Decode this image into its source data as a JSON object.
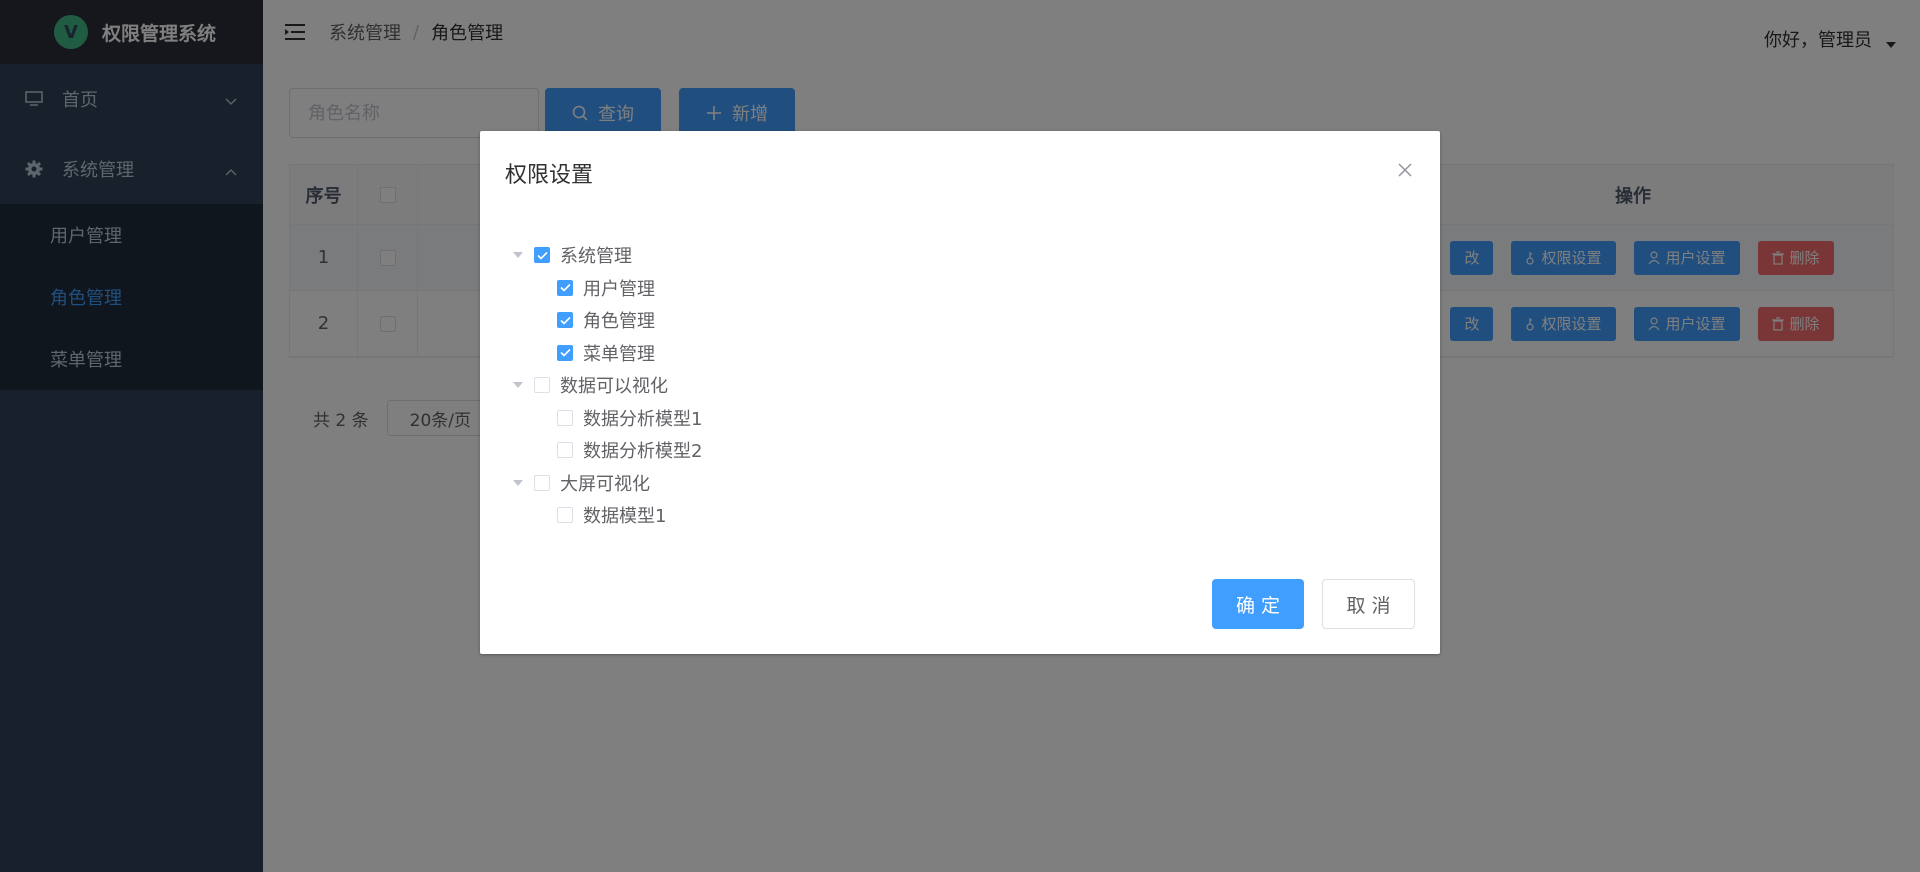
{
  "app": {
    "title": "权限管理系统",
    "logo_letter": "V"
  },
  "sidebar": {
    "items": [
      {
        "label": "首页",
        "icon": "monitor-icon"
      },
      {
        "label": "系统管理",
        "icon": "gear-icon"
      }
    ],
    "submenu": [
      {
        "label": "用户管理",
        "active": false
      },
      {
        "label": "角色管理",
        "active": true
      },
      {
        "label": "菜单管理",
        "active": false
      }
    ]
  },
  "header": {
    "breadcrumb": [
      "系统管理",
      "角色管理"
    ],
    "breadcrumb_sep": "/",
    "user_greeting": "你好，管理员"
  },
  "toolbar": {
    "search_placeholder": "角色名称",
    "query_label": "查询",
    "add_label": "新增"
  },
  "table": {
    "headers": {
      "index": "序号",
      "ops": "操作"
    },
    "rows": [
      {
        "index": "1"
      },
      {
        "index": "2"
      }
    ],
    "op_labels": {
      "edit": "改",
      "perm": "权限设置",
      "user": "用户设置",
      "delete": "删除"
    }
  },
  "pagination": {
    "total": "共 2 条",
    "page_size": "20条/页"
  },
  "dialog": {
    "title": "权限设置",
    "tree": [
      {
        "label": "系统管理",
        "checked": true,
        "children": [
          {
            "label": "用户管理",
            "checked": true
          },
          {
            "label": "角色管理",
            "checked": true
          },
          {
            "label": "菜单管理",
            "checked": true
          }
        ]
      },
      {
        "label": "数据可以视化",
        "checked": false,
        "children": [
          {
            "label": "数据分析模型1",
            "checked": false
          },
          {
            "label": "数据分析模型2",
            "checked": false
          }
        ]
      },
      {
        "label": "大屏可视化",
        "checked": false,
        "children": [
          {
            "label": "数据模型1",
            "checked": false
          }
        ]
      }
    ],
    "ok_label": "确 定",
    "cancel_label": "取 消"
  },
  "colors": {
    "primary": "#409eff",
    "danger": "#f56c6c",
    "sidebar_bg": "#304156"
  }
}
